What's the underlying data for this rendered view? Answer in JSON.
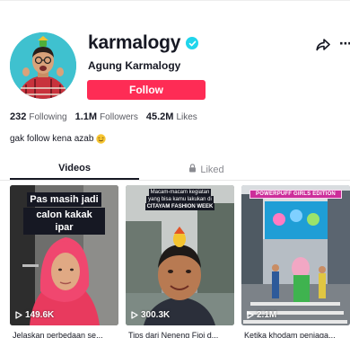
{
  "profile": {
    "username": "karmalogy",
    "nickname": "Agung Karmalogy",
    "follow_label": "Follow",
    "bio": "gak follow kena azab",
    "verified": true
  },
  "stats": {
    "following_count": "232",
    "following_label": "Following",
    "followers_count": "1.1M",
    "followers_label": "Followers",
    "likes_count": "45.2M",
    "likes_label": "Likes"
  },
  "tabs": {
    "videos": "Videos",
    "liked": "Liked"
  },
  "videos": [
    {
      "caption_lines": [
        "Pas masih jadi",
        "calon kakak ipar"
      ],
      "views": "149.6K",
      "description": "Jelaskan perbedaan se..."
    },
    {
      "caption_lines": [
        "Macam-macam kegiatan",
        "yang bisa kamu lakukan di",
        "CITAYAM FASHION WEEK"
      ],
      "views": "300.3K",
      "description": "Tips dari Neneng Fioi d..."
    },
    {
      "caption_lines": [
        "POWERPUFF GIRLS EDITION"
      ],
      "views": "2.1M",
      "description": "Ketika khodam penjaga..."
    }
  ],
  "colors": {
    "follow_button": "#fe2c55",
    "verified_badge": "#20d5ec",
    "text_primary": "#161823",
    "text_secondary": "#5b5c63"
  },
  "icons": {
    "share": "share-arrow-icon",
    "more": "more-dots-icon",
    "lock": "lock-icon",
    "play": "play-icon",
    "verified": "verified-check-icon"
  }
}
